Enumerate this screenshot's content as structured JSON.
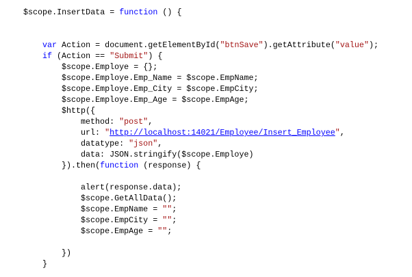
{
  "colors": {
    "keyword": "#0000ff",
    "string": "#a31515",
    "link": "#0000ff",
    "text": "#000000"
  },
  "code": {
    "lines": [
      {
        "indent": 0,
        "tokens": [
          {
            "t": "$scope.InsertData = ",
            "c": "plain"
          },
          {
            "t": "function",
            "c": "kw"
          },
          {
            "t": " () {",
            "c": "plain"
          }
        ]
      },
      {
        "indent": 0,
        "tokens": []
      },
      {
        "indent": 0,
        "tokens": []
      },
      {
        "indent": 1,
        "tokens": [
          {
            "t": "var",
            "c": "kw"
          },
          {
            "t": " Action = document.getElementById(",
            "c": "plain"
          },
          {
            "t": "\"btnSave\"",
            "c": "str"
          },
          {
            "t": ").getAttribute(",
            "c": "plain"
          },
          {
            "t": "\"value\"",
            "c": "str"
          },
          {
            "t": ");",
            "c": "plain"
          }
        ]
      },
      {
        "indent": 1,
        "tokens": [
          {
            "t": "if",
            "c": "kw"
          },
          {
            "t": " (Action == ",
            "c": "plain"
          },
          {
            "t": "\"Submit\"",
            "c": "str"
          },
          {
            "t": ") {",
            "c": "plain"
          }
        ]
      },
      {
        "indent": 2,
        "tokens": [
          {
            "t": "$scope.Employe = {};",
            "c": "plain"
          }
        ]
      },
      {
        "indent": 2,
        "tokens": [
          {
            "t": "$scope.Employe.Emp_Name = $scope.EmpName;",
            "c": "plain"
          }
        ]
      },
      {
        "indent": 2,
        "tokens": [
          {
            "t": "$scope.Employe.Emp_City = $scope.EmpCity;",
            "c": "plain"
          }
        ]
      },
      {
        "indent": 2,
        "tokens": [
          {
            "t": "$scope.Employe.Emp_Age = $scope.EmpAge;",
            "c": "plain"
          }
        ]
      },
      {
        "indent": 2,
        "tokens": [
          {
            "t": "$http({",
            "c": "plain"
          }
        ]
      },
      {
        "indent": 3,
        "tokens": [
          {
            "t": "method: ",
            "c": "plain"
          },
          {
            "t": "\"post\"",
            "c": "str"
          },
          {
            "t": ",",
            "c": "plain"
          }
        ]
      },
      {
        "indent": 3,
        "tokens": [
          {
            "t": "url: ",
            "c": "plain"
          },
          {
            "t": "\"",
            "c": "str"
          },
          {
            "t": "http://localhost:14021/Employee/Insert_Employee",
            "c": "link"
          },
          {
            "t": "\"",
            "c": "str"
          },
          {
            "t": ",",
            "c": "plain"
          }
        ]
      },
      {
        "indent": 3,
        "tokens": [
          {
            "t": "datatype: ",
            "c": "plain"
          },
          {
            "t": "\"json\"",
            "c": "str"
          },
          {
            "t": ",",
            "c": "plain"
          }
        ]
      },
      {
        "indent": 3,
        "tokens": [
          {
            "t": "data: JSON.stringify($scope.Employe)",
            "c": "plain"
          }
        ]
      },
      {
        "indent": 2,
        "tokens": [
          {
            "t": "}).then(",
            "c": "plain"
          },
          {
            "t": "function",
            "c": "kw"
          },
          {
            "t": " (response) {",
            "c": "plain"
          }
        ]
      },
      {
        "indent": 0,
        "tokens": []
      },
      {
        "indent": 3,
        "tokens": [
          {
            "t": "alert(response.data);",
            "c": "plain"
          }
        ]
      },
      {
        "indent": 3,
        "tokens": [
          {
            "t": "$scope.GetAllData();",
            "c": "plain"
          }
        ]
      },
      {
        "indent": 3,
        "tokens": [
          {
            "t": "$scope.EmpName = ",
            "c": "plain"
          },
          {
            "t": "\"\"",
            "c": "str"
          },
          {
            "t": ";",
            "c": "plain"
          }
        ]
      },
      {
        "indent": 3,
        "tokens": [
          {
            "t": "$scope.EmpCity = ",
            "c": "plain"
          },
          {
            "t": "\"\"",
            "c": "str"
          },
          {
            "t": ";",
            "c": "plain"
          }
        ]
      },
      {
        "indent": 3,
        "tokens": [
          {
            "t": "$scope.EmpAge = ",
            "c": "plain"
          },
          {
            "t": "\"\"",
            "c": "str"
          },
          {
            "t": ";",
            "c": "plain"
          }
        ]
      },
      {
        "indent": 0,
        "tokens": []
      },
      {
        "indent": 2,
        "tokens": [
          {
            "t": "})",
            "c": "plain"
          }
        ]
      },
      {
        "indent": 1,
        "tokens": [
          {
            "t": "}",
            "c": "plain"
          }
        ]
      }
    ]
  }
}
